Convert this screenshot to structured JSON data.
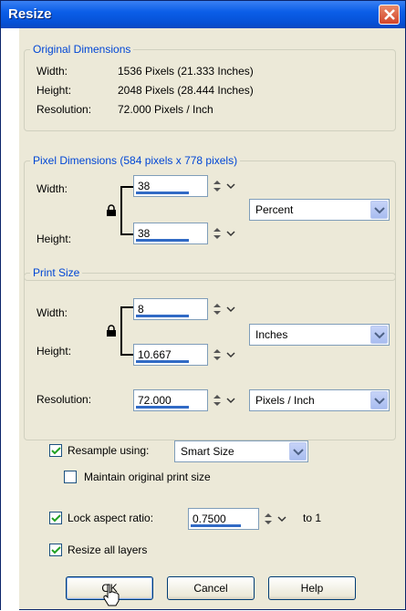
{
  "window": {
    "title": "Resize"
  },
  "original": {
    "group_label": "Original Dimensions",
    "width_label": "Width:",
    "width_value": "1536 Pixels (21.333 Inches)",
    "height_label": "Height:",
    "height_value": "2048 Pixels (28.444 Inches)",
    "resolution_label": "Resolution:",
    "resolution_value": "72.000 Pixels / Inch"
  },
  "pixel": {
    "group_label": "Pixel Dimensions (584 pixels x 778 pixels)",
    "width_label": "Width:",
    "width_value": "38",
    "height_label": "Height:",
    "height_value": "38",
    "unit": "Percent"
  },
  "print": {
    "group_label": "Print Size",
    "width_label": "Width:",
    "width_value": "8",
    "height_label": "Height:",
    "height_value": "10.667",
    "unit": "Inches",
    "resolution_label": "Resolution:",
    "resolution_value": "72.000",
    "resolution_unit": "Pixels / Inch"
  },
  "options": {
    "resample_label": "Resample using:",
    "resample_checked": true,
    "resample_method": "Smart Size",
    "maintain_label": "Maintain original print size",
    "maintain_checked": false,
    "lock_label": "Lock aspect ratio:",
    "lock_checked": true,
    "ratio_value": "0.7500",
    "ratio_suffix": "to 1",
    "resize_layers_label": "Resize all layers",
    "resize_layers_checked": true
  },
  "buttons": {
    "ok": "OK",
    "cancel": "Cancel",
    "help": "Help"
  },
  "colors": {
    "titlebar": "#0b5ee8",
    "group_label": "#0046d5",
    "window_bg": "#ece9d8"
  }
}
